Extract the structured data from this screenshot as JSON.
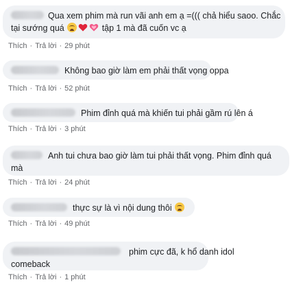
{
  "comments": [
    {
      "text_line1": "Qua xem phim mà run vãi anh em ạ =((( chả hiểu saoo. Chắc",
      "text_line2_a": "tại sướng quá",
      "text_line2_b": " tập 1 mà đã cuốn vc ạ",
      "emojis": [
        "crying-face",
        "red-heart",
        "growing-heart"
      ],
      "like": "Thích",
      "reply": "Trả lời",
      "time": "29 phút"
    },
    {
      "text": "Không bao giờ làm em phải thất vọng oppa",
      "like": "Thích",
      "reply": "Trả lời",
      "time": "52 phút"
    },
    {
      "text": "Phim đỉnh quá mà khiến tui phải gầm rú lên á",
      "like": "Thích",
      "reply": "Trả lời",
      "time": "3 phút"
    },
    {
      "text_line1": "Anh tui chưa bao giờ làm tui phải thất vọng. Phim đỉnh quá",
      "text_line2": "mà",
      "like": "Thích",
      "reply": "Trả lời",
      "time": "24 phút"
    },
    {
      "text": "thực sự là vì nội dung thôi",
      "emojis": [
        "crying-face"
      ],
      "like": "Thích",
      "reply": "Trả lời",
      "time": "49 phút"
    },
    {
      "text_line1": "phim cực đã, k hổ danh idol",
      "text_line2": "comeback",
      "like": "Thích",
      "reply": "Trả lời",
      "time": "1 phút"
    }
  ],
  "colors": {
    "bubble": "#f0f2f5",
    "meta": "#65676b",
    "heart_red": "#e0243a",
    "heart_pink": "#f25a8a"
  }
}
